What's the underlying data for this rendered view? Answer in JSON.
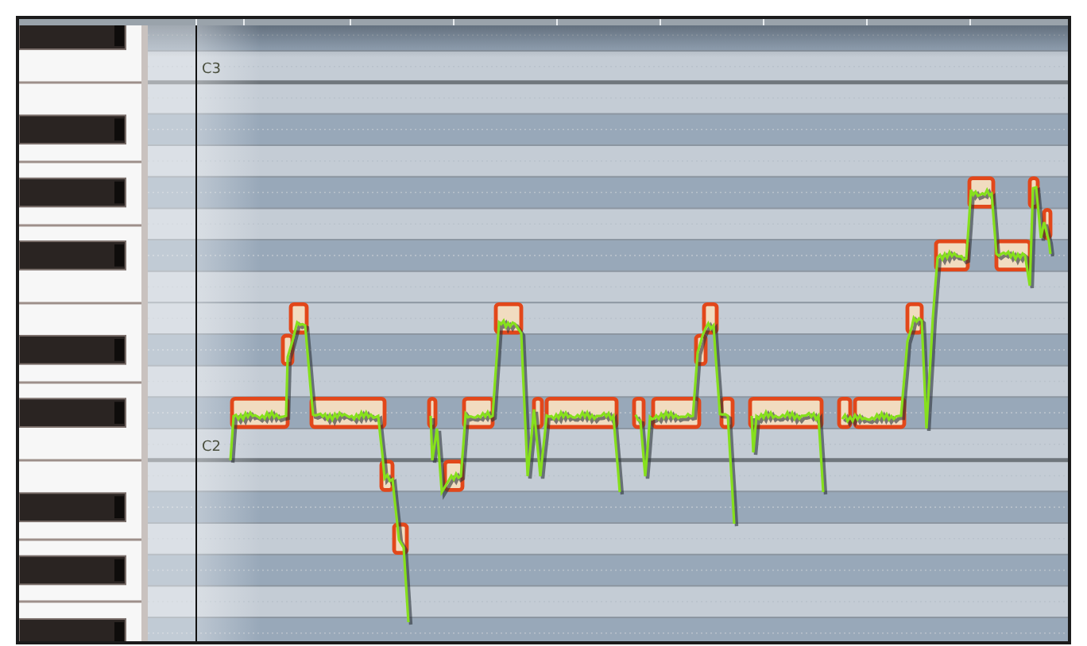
{
  "note_labels": [
    {
      "text": "C3"
    },
    {
      "text": "C2"
    }
  ]
}
